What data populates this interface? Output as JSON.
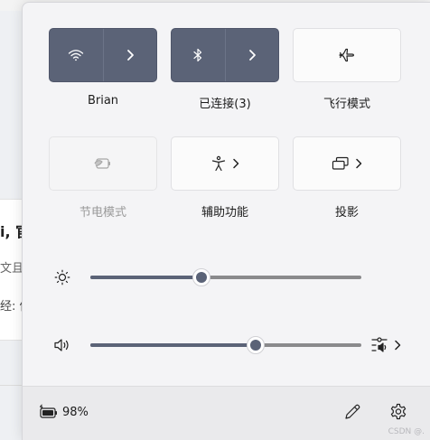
{
  "background": {
    "title_fragment": "i, 官",
    "line2_fragment": "文且官",
    "line3_fragment": "经: 信"
  },
  "tiles": [
    {
      "label": "Brian",
      "icon": "wifi-icon",
      "state": "on",
      "has_chevron": true
    },
    {
      "label": "已连接(3)",
      "icon": "bluetooth-icon",
      "state": "on",
      "has_chevron": true
    },
    {
      "label": "飞行模式",
      "icon": "airplane-icon",
      "state": "off",
      "has_chevron": false
    },
    {
      "label": "节电模式",
      "icon": "battery-saver-icon",
      "state": "disabled",
      "has_chevron": false
    },
    {
      "label": "辅助功能",
      "icon": "accessibility-icon",
      "state": "off",
      "has_chevron": true
    },
    {
      "label": "投影",
      "icon": "project-icon",
      "state": "off",
      "has_chevron": true
    }
  ],
  "brightness": {
    "icon": "sun-icon",
    "value_fraction": 0.41
  },
  "volume": {
    "icon": "speaker-icon",
    "value_fraction": 0.61,
    "trailing_icon": "audio-mixer-icon"
  },
  "battery": {
    "icon": "battery-charging-icon",
    "percent_text": "98%"
  },
  "footer_actions": {
    "edit_icon": "pencil-icon",
    "settings_icon": "gear-icon"
  },
  "watermark": "CSDN @."
}
